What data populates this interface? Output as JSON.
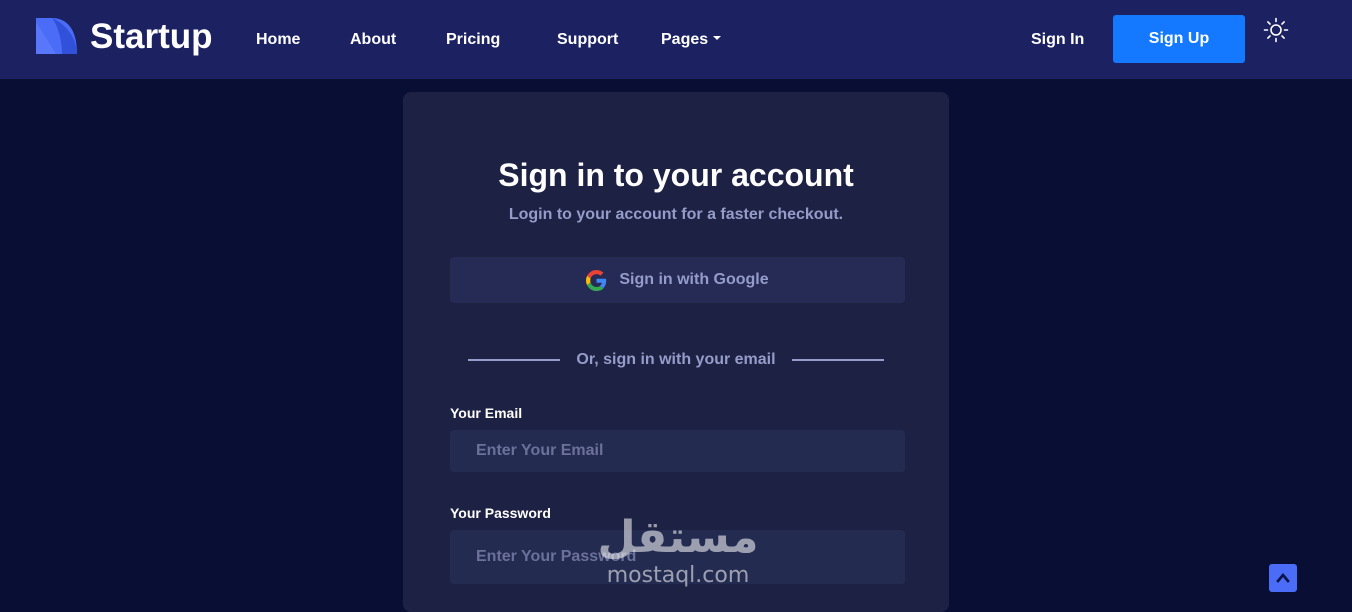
{
  "colors": {
    "background": "#090e34",
    "navbar": "#1b2161",
    "card": "#1d2144",
    "accent": "#1479ff",
    "muted_text": "#959cc9",
    "input_bg": "#242b51",
    "scroll_top": "#4a6cf7"
  },
  "header": {
    "logo_text": "Startup",
    "nav": {
      "home": "Home",
      "about": "About",
      "pricing": "Pricing",
      "support": "Support",
      "pages": "Pages"
    },
    "sign_in": "Sign In",
    "sign_up": "Sign Up",
    "theme_icon": "sun-icon"
  },
  "form": {
    "title": "Sign in to your account",
    "subtitle": "Login to your account for a faster checkout.",
    "google_label": "Sign in with Google",
    "divider_text": "Or, sign in with your email",
    "email_label": "Your Email",
    "email_placeholder": "Enter Your Email",
    "email_value": "",
    "password_label": "Your Password",
    "password_placeholder": "Enter Your Password",
    "password_value": ""
  },
  "watermark": {
    "arabic": "مستقل",
    "latin": "mostaql.com"
  },
  "scroll_top_icon": "chevron-up-icon"
}
